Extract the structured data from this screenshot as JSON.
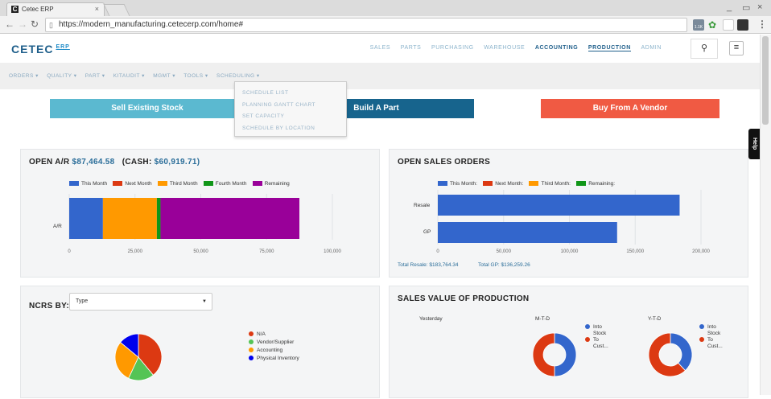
{
  "browser": {
    "tab_title": "Cetec ERP",
    "tab_icon": "C",
    "tab_close": "×",
    "url": "https://modern_manufacturing.cetecerp.com/home#",
    "window_buttons": [
      "_",
      "▭",
      "×"
    ],
    "ext_badge": "1.1K"
  },
  "header": {
    "logo": "CETEC",
    "logo_sup": "ERP",
    "nav": [
      "SALES",
      "PARTS",
      "PURCHASING",
      "WAREHOUSE",
      "ACCOUNTING",
      "PRODUCTION",
      "ADMIN"
    ]
  },
  "subnav": {
    "items": [
      "ORDERS ▾",
      "QUALITY ▾",
      "PART ▾",
      "KITAUDIT ▾",
      "MGMT ▾",
      "TOOLS ▾",
      "SCHEDULING ▾"
    ]
  },
  "scheduling_menu": [
    "SCHEDULE LIST",
    "PLANNING GANTT CHART",
    "SET CAPACITY",
    "SCHEDULE BY LOCATION"
  ],
  "actions": {
    "sell": "Sell Existing Stock",
    "build": "Build A Part",
    "buy": "Buy From A Vendor"
  },
  "help_label": "Help",
  "ar_panel": {
    "title": "OPEN A/R",
    "amount": "$87,464.58",
    "cash_prefix": "(CASH:",
    "cash": "$60,919.71)"
  },
  "so_panel": {
    "title": "OPEN SALES ORDERS",
    "total_resale": "Total Resale: $183,764.34",
    "total_gp": "Total GP: $136,259.26"
  },
  "ncrs_panel": {
    "title": "NCRS BY:",
    "selected": "Type"
  },
  "svp_panel": {
    "title": "SALES VALUE OF PRODUCTION",
    "yesterday": "Yesterday",
    "mtd": "M-T-D",
    "ytd": "Y-T-D",
    "legend": [
      "Into\nStock",
      "To\nCust..."
    ]
  },
  "colors": {
    "sell": "#5bb9d0",
    "build": "#17648d",
    "buy": "#f05a43",
    "blue": "#3366cc",
    "red": "#dc3912",
    "orange": "#ff9900",
    "green": "#109618",
    "purple": "#990099"
  },
  "chart_data": [
    {
      "type": "bar",
      "orientation": "horizontal",
      "stacked": true,
      "categories": [
        "A/R"
      ],
      "series": [
        {
          "name": "This Month",
          "values": [
            12800
          ],
          "color": "#3366cc"
        },
        {
          "name": "Next Month",
          "values": [
            0
          ],
          "color": "#dc3912"
        },
        {
          "name": "Third Month",
          "values": [
            20500
          ],
          "color": "#ff9900"
        },
        {
          "name": "Fourth Month",
          "values": [
            1400
          ],
          "color": "#109618"
        },
        {
          "name": "Remaining",
          "values": [
            52764
          ],
          "color": "#990099"
        }
      ],
      "xticks": [
        "0",
        "25,000",
        "50,000",
        "75,000",
        "100,000"
      ],
      "xlim": [
        0,
        100000
      ],
      "legend": "top"
    },
    {
      "type": "bar",
      "orientation": "horizontal",
      "categories": [
        "Resale",
        "GP"
      ],
      "series": [
        {
          "name": "This Month:",
          "values": [
            183764,
            136259
          ],
          "color": "#3366cc"
        },
        {
          "name": "Next Month:",
          "values": [
            0,
            0
          ],
          "color": "#dc3912"
        },
        {
          "name": "Third Month:",
          "values": [
            0,
            0
          ],
          "color": "#ff9900"
        },
        {
          "name": "Remaining:",
          "values": [
            0,
            0
          ],
          "color": "#109618"
        }
      ],
      "xticks": [
        "0",
        "50,000",
        "100,000",
        "150,000",
        "200,000"
      ],
      "xlim": [
        0,
        200000
      ],
      "legend": "top"
    },
    {
      "type": "pie",
      "labels": [
        "N/A",
        "Vendor/Supplier",
        "Accounting",
        "Physical Inventory"
      ],
      "values": [
        39,
        18,
        29,
        14
      ],
      "colors": [
        "#dc3912",
        "#55c455",
        "#ff9900",
        "#0000ee"
      ]
    },
    {
      "type": "pie",
      "donut": true,
      "title": "M-T-D",
      "labels": [
        "Into Stock",
        "To Cust..."
      ],
      "values": [
        50,
        50
      ],
      "colors": [
        "#3366cc",
        "#dc3912"
      ]
    },
    {
      "type": "pie",
      "donut": true,
      "title": "Y-T-D",
      "labels": [
        "Into Stock",
        "To Cust..."
      ],
      "values": [
        38,
        62
      ],
      "colors": [
        "#3366cc",
        "#dc3912"
      ]
    }
  ]
}
